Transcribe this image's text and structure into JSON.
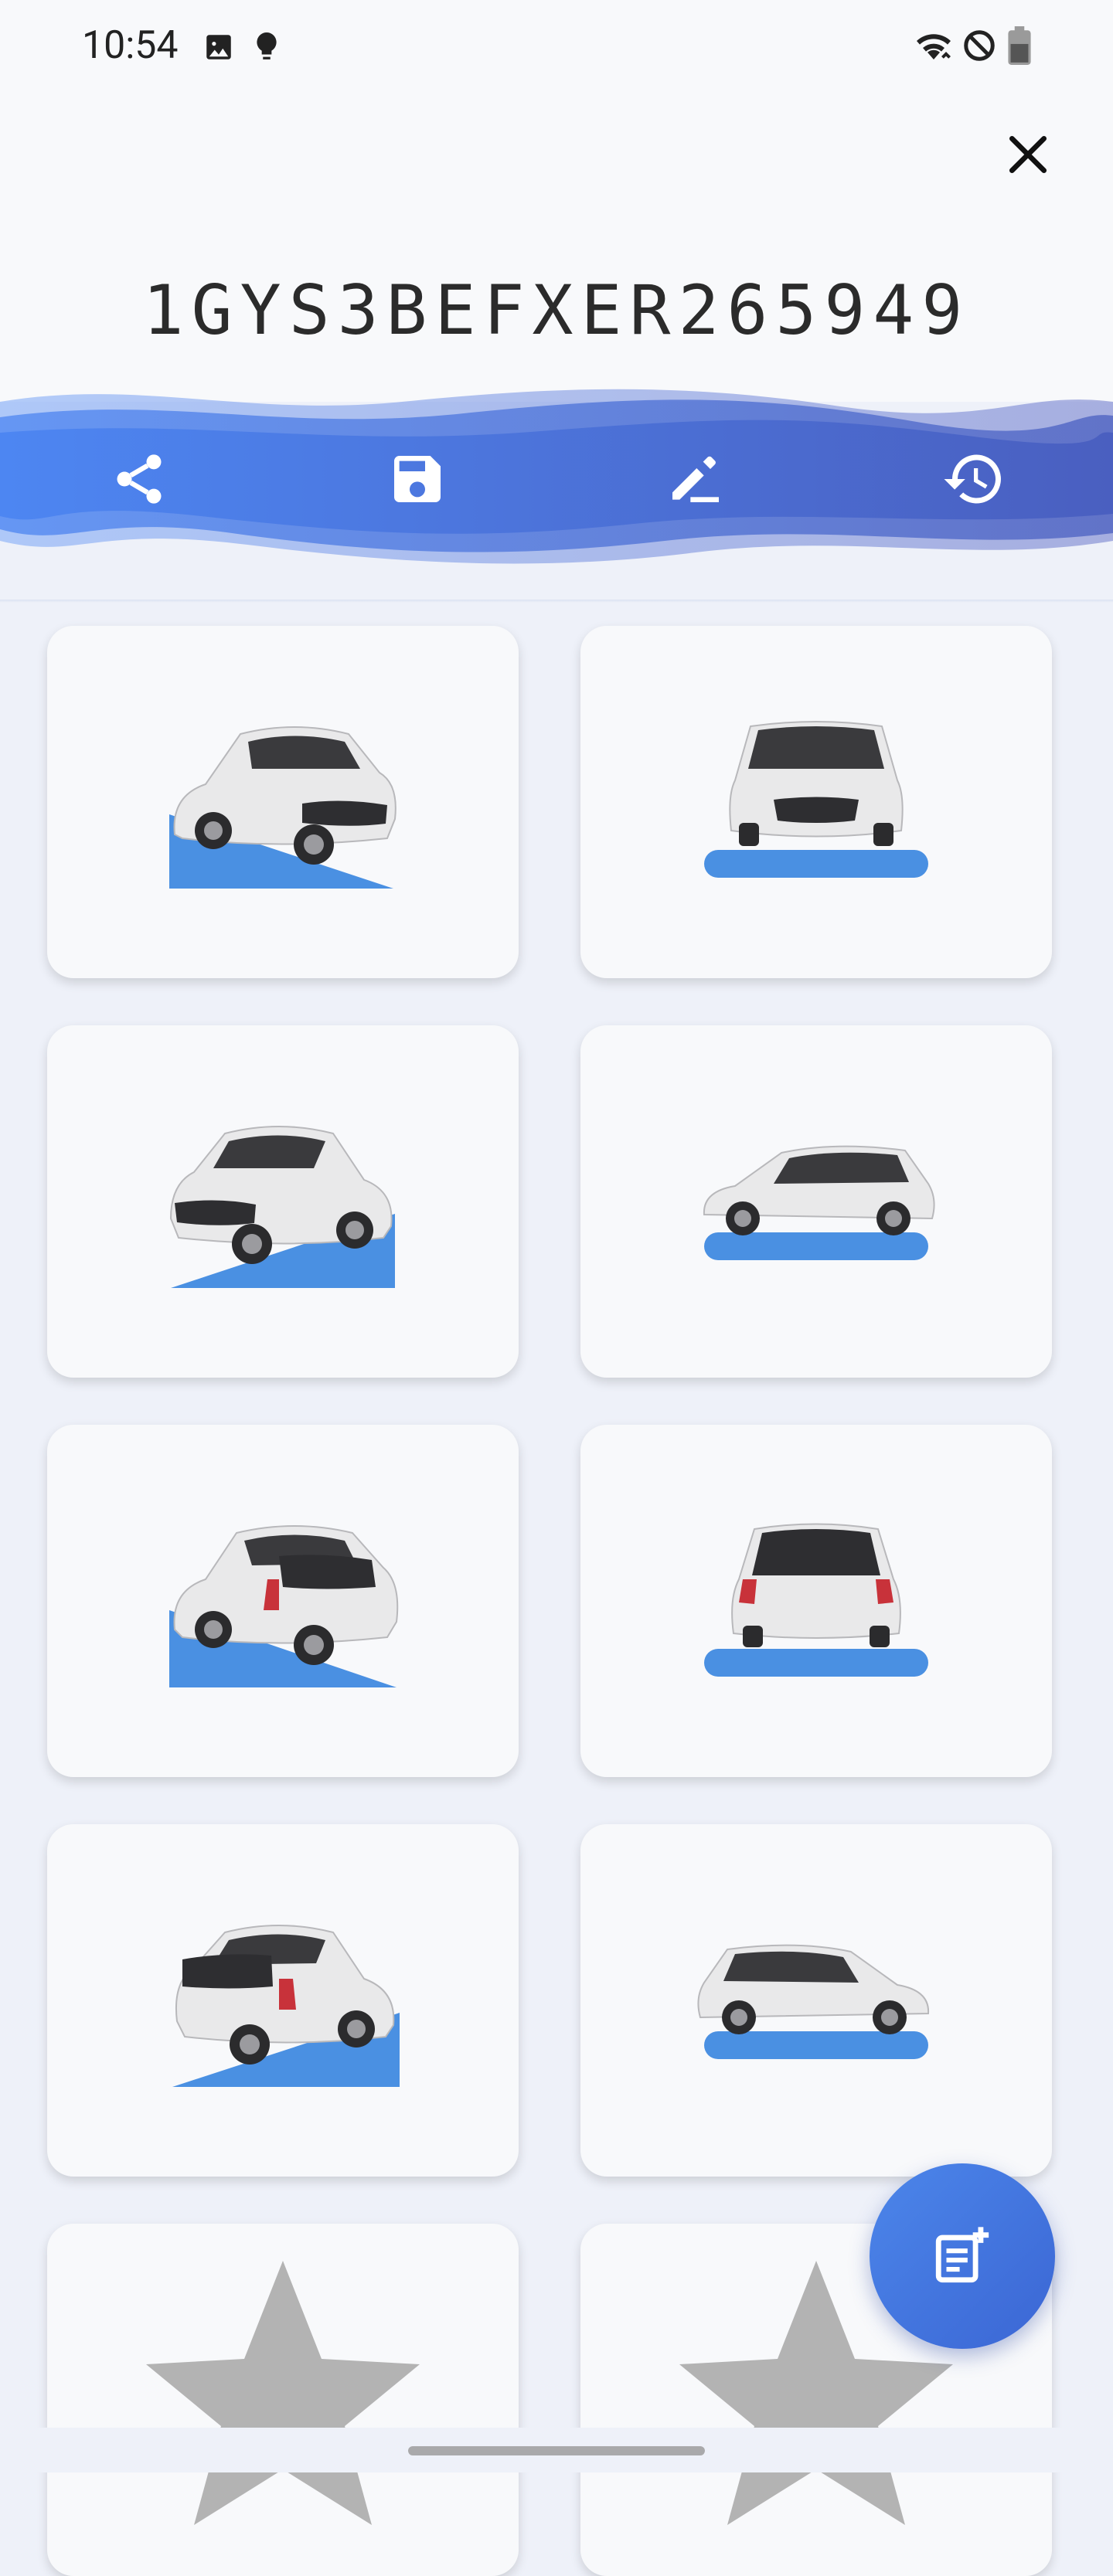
{
  "status_bar": {
    "time": "10:54",
    "icons": [
      "image-icon",
      "bulb-icon",
      "wifi-icon",
      "dnd-icon",
      "battery-icon"
    ]
  },
  "header": {
    "vin": "1GYS3BEFXER265949",
    "close_icon": "close-icon"
  },
  "toolbar": {
    "actions": [
      "share-icon",
      "save-icon",
      "edit-icon",
      "history-icon"
    ],
    "accent": "#4a7fe8"
  },
  "gallery": {
    "cards": [
      "car-front-three-quarter-left-ramp",
      "car-front-view-flat",
      "car-front-three-quarter-right-ramp",
      "car-side-view-flat",
      "car-rear-three-quarter-left-ramp",
      "car-rear-view-flat",
      "car-rear-three-quarter-right-ramp",
      "car-side-view-right-flat",
      "star-placeholder",
      "star-placeholder"
    ],
    "ramp_color": "#4a90e2",
    "placeholder_color": "#b3b3b3"
  },
  "fab": {
    "icon": "add-note-icon"
  }
}
